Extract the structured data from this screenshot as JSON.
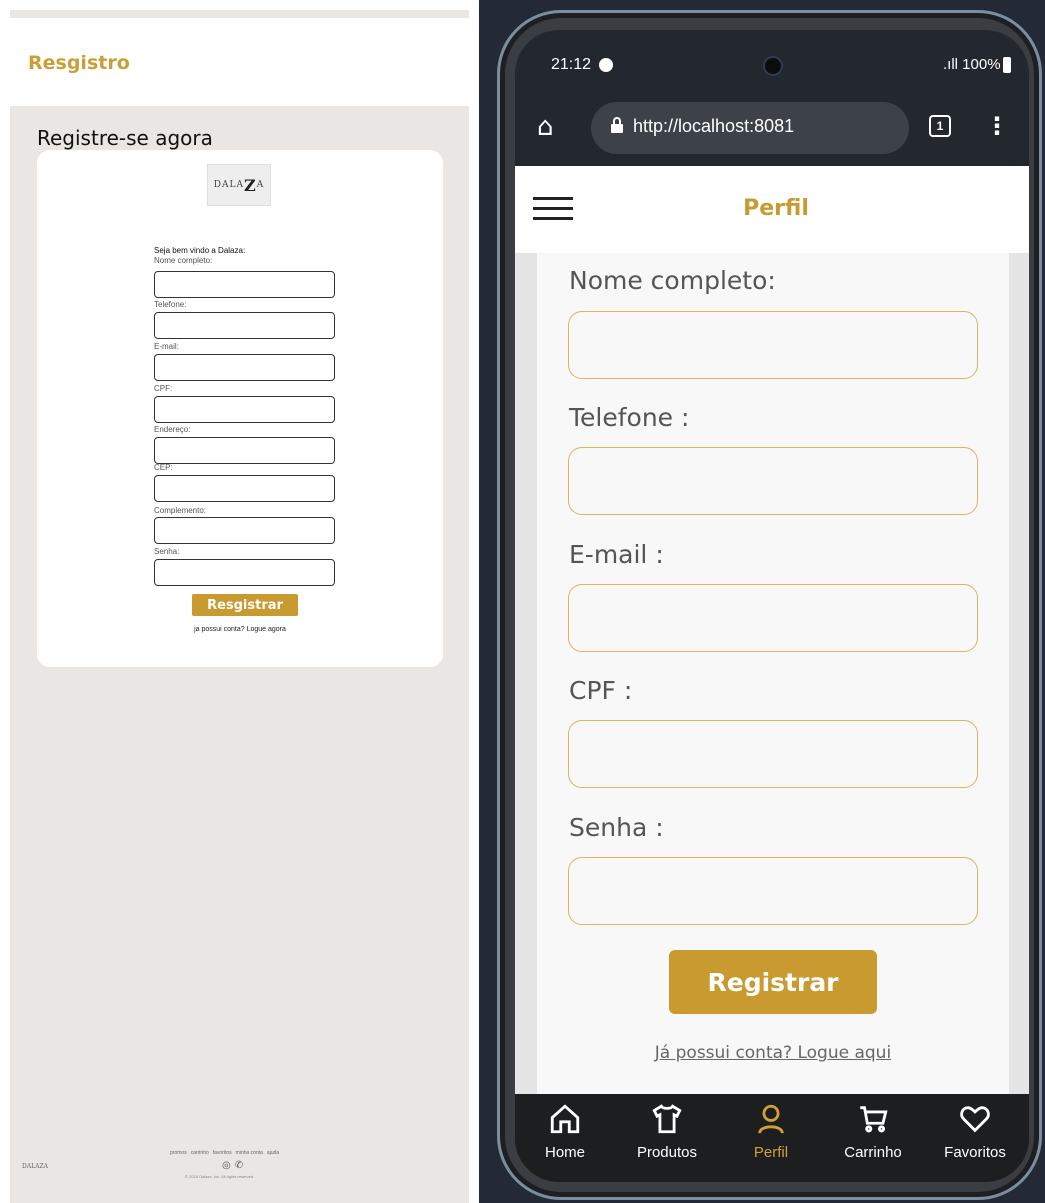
{
  "desktop": {
    "header_title": "Resgistro",
    "heading": "Registre-se agora",
    "logo_text": "DALA",
    "logo_z": "Z",
    "logo_a": "A",
    "welcome": "Seja bem vindo a Dalaza:",
    "fields": [
      {
        "label": "Nome completo:"
      },
      {
        "label": "Telefone:"
      },
      {
        "label": "E-mail:"
      },
      {
        "label": "CPF:"
      },
      {
        "label": "Endereço:"
      },
      {
        "label": "CEP:"
      },
      {
        "label": "Complemento:"
      },
      {
        "label": "Senha:"
      }
    ],
    "submit_label": "Resgistrar",
    "login_link": "ja possui conta? Logue agora",
    "footer": {
      "logo_text": "DALAZA",
      "links": [
        "promos",
        "carrinho",
        "favoritos",
        "minha conta",
        "ajuda"
      ],
      "copyright": "© 2024 Dalaza, Inc. All rights reserved."
    }
  },
  "mobile": {
    "status": {
      "time": "21:12",
      "battery": ".ıll 100%"
    },
    "browser": {
      "url": "http://localhost:8081",
      "tab_count": "1"
    },
    "header_title": "Perfil",
    "fields": [
      {
        "label": "Nome completo:"
      },
      {
        "label": "Telefone :"
      },
      {
        "label": "E-mail :"
      },
      {
        "label": "CPF :"
      },
      {
        "label": "Senha :"
      }
    ],
    "submit_label": "Registrar",
    "login_link": "Já possui conta? Logue aqui",
    "nav": [
      {
        "label": "Home",
        "icon": "home-icon"
      },
      {
        "label": "Produtos",
        "icon": "shirt-icon"
      },
      {
        "label": "Perfil",
        "icon": "user-icon",
        "active": true
      },
      {
        "label": "Carrinho",
        "icon": "cart-icon"
      },
      {
        "label": "Favoritos",
        "icon": "heart-icon"
      }
    ]
  },
  "colors": {
    "accent": "#c99a30",
    "input_border_mobile": "#d8b560",
    "nav_bg": "#1d1e20"
  }
}
